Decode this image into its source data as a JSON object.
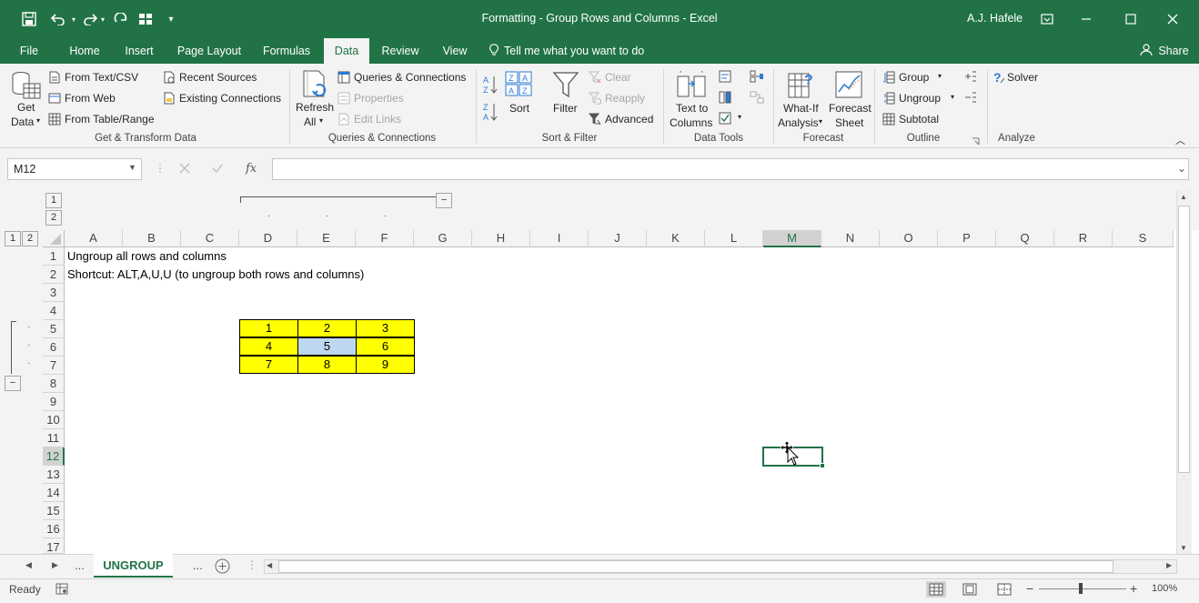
{
  "titlebar": {
    "title": "Formatting - Group Rows and Columns  -  Excel",
    "user": "A.J. Hafele"
  },
  "ribbon_tabs": [
    "File",
    "Home",
    "Insert",
    "Page Layout",
    "Formulas",
    "Data",
    "Review",
    "View"
  ],
  "active_tab": "Data",
  "tell_me": "Tell me what you want to do",
  "share": "Share",
  "ribbon": {
    "get_data": [
      "Get",
      "Data"
    ],
    "from_text_csv": "From Text/CSV",
    "from_web": "From Web",
    "from_table_range": "From Table/Range",
    "recent_sources": "Recent Sources",
    "existing_connections": "Existing Connections",
    "group_get_transform": "Get & Transform Data",
    "refresh_all": [
      "Refresh",
      "All"
    ],
    "queries_connections": "Queries & Connections",
    "properties": "Properties",
    "edit_links": "Edit Links",
    "group_queries": "Queries & Connections",
    "sort": "Sort",
    "filter": "Filter",
    "clear": "Clear",
    "reapply": "Reapply",
    "advanced": "Advanced",
    "group_sort_filter": "Sort & Filter",
    "text_to_columns": [
      "Text to",
      "Columns"
    ],
    "group_data_tools": "Data Tools",
    "what_if": [
      "What-If",
      "Analysis"
    ],
    "forecast_sheet": [
      "Forecast",
      "Sheet"
    ],
    "group_forecast": "Forecast",
    "group_btn": "Group",
    "ungroup_btn": "Ungroup",
    "subtotal_btn": "Subtotal",
    "group_outline": "Outline",
    "solver": "Solver",
    "group_analyze": "Analyze"
  },
  "formula_bar": {
    "name_box": "M12",
    "fx": "fx",
    "formula": ""
  },
  "columns": [
    "A",
    "B",
    "C",
    "D",
    "E",
    "F",
    "G",
    "H",
    "I",
    "J",
    "K",
    "L",
    "M",
    "N",
    "O",
    "P",
    "Q",
    "R",
    "S"
  ],
  "selected_column": "M",
  "rows": [
    "1",
    "2",
    "3",
    "4",
    "5",
    "6",
    "7",
    "8",
    "9",
    "10",
    "11",
    "12",
    "13",
    "14",
    "15",
    "16",
    "17"
  ],
  "selected_row": "12",
  "outline_levels": [
    "1",
    "2"
  ],
  "cells": {
    "a1": "Ungroup all rows and columns",
    "a2": "Shortcut: ALT,A,U,U (to ungroup both rows and columns)"
  },
  "table": [
    [
      "1",
      "2",
      "3"
    ],
    [
      "4",
      "5",
      "6"
    ],
    [
      "7",
      "8",
      "9"
    ]
  ],
  "sheets": {
    "prev_more": "...",
    "active": "UNGROUP",
    "next_more": "..."
  },
  "status": {
    "ready": "Ready",
    "zoom": "100%"
  },
  "colors": {
    "excel_green": "#217346",
    "table_fill": "#ffff00",
    "selected_cell_fill": "#bdd7ee"
  }
}
